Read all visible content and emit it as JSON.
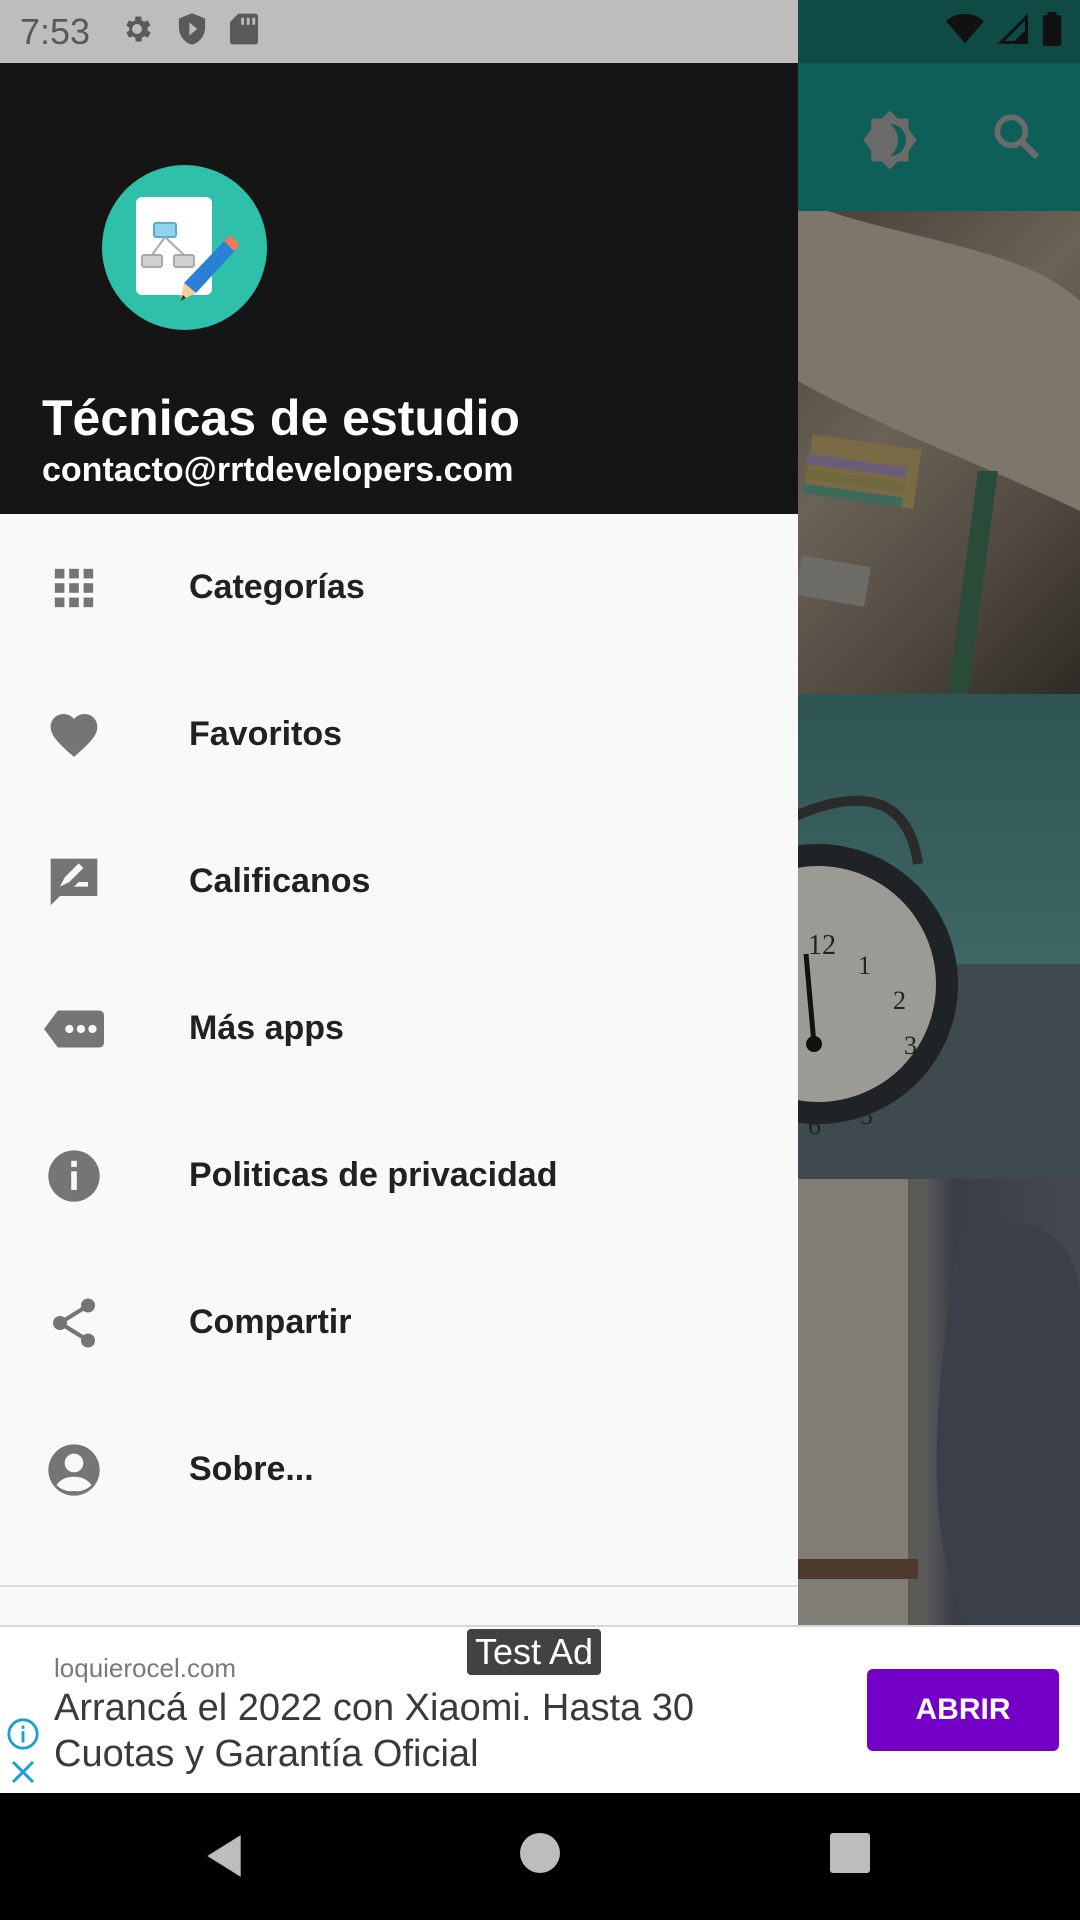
{
  "status_bar": {
    "time": "7:53",
    "left_icons": [
      "settings-icon",
      "shield-play-icon",
      "sd-card-icon"
    ],
    "right_icons": [
      "wifi-icon",
      "signal-icon",
      "battery-icon"
    ]
  },
  "app_toolbar": {
    "icons": [
      "brightness-icon",
      "search-icon"
    ],
    "color": "#0e5f58"
  },
  "drawer": {
    "header": {
      "title": "Técnicas de estudio",
      "email": "contacto@rrtdevelopers.com",
      "logo_icon": "app-logo-icon",
      "logo_color": "#2ec0a8"
    },
    "items": [
      {
        "label": "Categorías",
        "icon": "grid-icon"
      },
      {
        "label": "Favoritos",
        "icon": "heart-icon"
      },
      {
        "label": "Calificanos",
        "icon": "rate-review-icon"
      },
      {
        "label": "Más apps",
        "icon": "more-apps-icon"
      },
      {
        "label": "Politicas de privacidad",
        "icon": "info-icon"
      },
      {
        "label": "Compartir",
        "icon": "share-icon"
      },
      {
        "label": "Sobre...",
        "icon": "account-icon"
      }
    ]
  },
  "ad": {
    "tag": "Test Ad",
    "domain": "loquierocel.com",
    "headline": "Arrancá el 2022 con Xiaomi. Hasta 30 Cuotas y Garantía Oficial",
    "button": "ABRIR",
    "button_color": "#7400c8"
  },
  "nav_bar": {
    "icons": [
      "back-icon",
      "home-icon",
      "recents-icon"
    ]
  }
}
